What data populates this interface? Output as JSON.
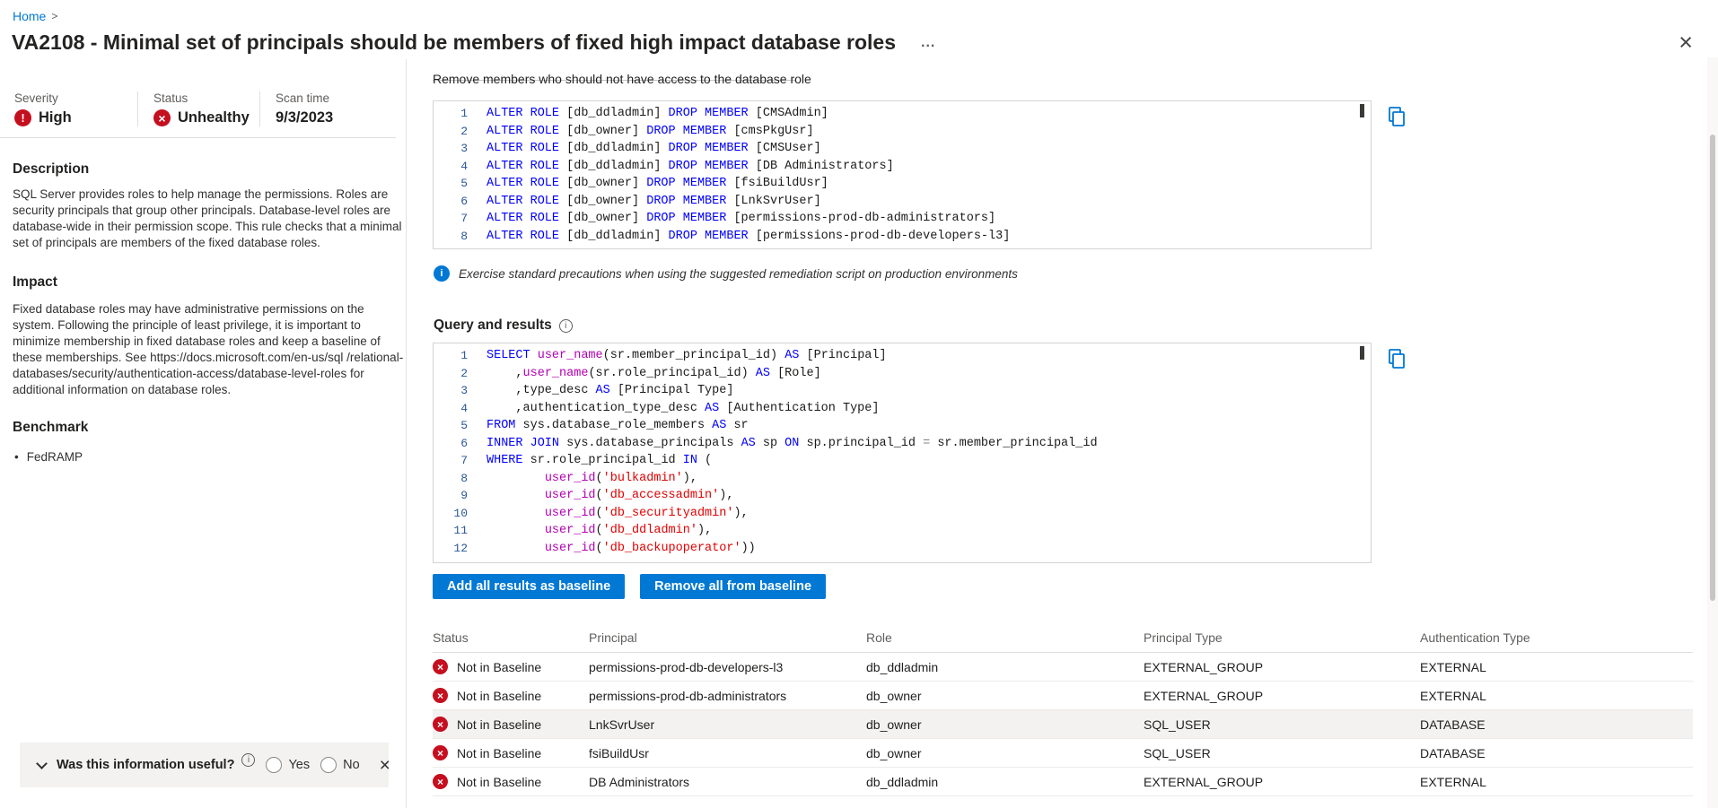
{
  "colors": {
    "accent": "#0078d4",
    "error": "#c50f1f",
    "keyword": "#0000ff",
    "function": "#b300b3",
    "string": "#e00000",
    "operator": "#808080",
    "line_number": "#2b5797"
  },
  "icons": {
    "exclamation": "!",
    "cross": "×",
    "info_i": "i",
    "bullet": "•"
  },
  "breadcrumb": {
    "home": "Home",
    "separator": ">"
  },
  "header": {
    "title": "VA2108 - Minimal set of principals should be members of fixed high impact database roles",
    "more": "...",
    "close": "×"
  },
  "meta": {
    "severity": {
      "label": "Severity",
      "value": "High"
    },
    "status": {
      "label": "Status",
      "value": "Unhealthy"
    },
    "scan": {
      "label": "Scan time",
      "value": "9/3/2023"
    }
  },
  "sidebar": {
    "description": {
      "title": "Description",
      "body": "SQL Server provides roles to help manage the permissions. Roles are security principals that group other principals. Database-level roles are database-wide in their permission scope. This rule checks that a minimal set of principals are members of the fixed database roles."
    },
    "impact": {
      "title": "Impact",
      "body": "Fixed database roles may have administrative permissions on the system. Following the principle of least privilege, it is important to minimize membership in fixed database roles and keep a baseline of these memberships. See https://docs.microsoft.com/en-us/sql /relational-databases/security/authentication-access/database-level-roles for additional information on database roles."
    },
    "benchmark": {
      "title": "Benchmark",
      "items": [
        "FedRAMP"
      ]
    }
  },
  "main": {
    "clipped_heading": "Remove members who should not have access to the database role",
    "remediation": {
      "lines": [
        [
          [
            "k",
            "ALTER ROLE"
          ],
          [
            "p",
            " [db_ddladmin] "
          ],
          [
            "k",
            "DROP MEMBER"
          ],
          [
            "p",
            " [CMSAdmin]"
          ]
        ],
        [
          [
            "k",
            "ALTER ROLE"
          ],
          [
            "p",
            " [db_owner] "
          ],
          [
            "k",
            "DROP MEMBER"
          ],
          [
            "p",
            " [cmsPkgUsr]"
          ]
        ],
        [
          [
            "k",
            "ALTER ROLE"
          ],
          [
            "p",
            " [db_ddladmin] "
          ],
          [
            "k",
            "DROP MEMBER"
          ],
          [
            "p",
            " [CMSUser]"
          ]
        ],
        [
          [
            "k",
            "ALTER ROLE"
          ],
          [
            "p",
            " [db_ddladmin] "
          ],
          [
            "k",
            "DROP MEMBER"
          ],
          [
            "p",
            " [DB Administrators]"
          ]
        ],
        [
          [
            "k",
            "ALTER ROLE"
          ],
          [
            "p",
            " [db_owner] "
          ],
          [
            "k",
            "DROP MEMBER"
          ],
          [
            "p",
            " [fsiBuildUsr]"
          ]
        ],
        [
          [
            "k",
            "ALTER ROLE"
          ],
          [
            "p",
            " [db_owner] "
          ],
          [
            "k",
            "DROP MEMBER"
          ],
          [
            "p",
            " [LnkSvrUser]"
          ]
        ],
        [
          [
            "k",
            "ALTER ROLE"
          ],
          [
            "p",
            " [db_owner] "
          ],
          [
            "k",
            "DROP MEMBER"
          ],
          [
            "p",
            " [permissions-prod-db-administrators]"
          ]
        ],
        [
          [
            "k",
            "ALTER ROLE"
          ],
          [
            "p",
            " [db_ddladmin] "
          ],
          [
            "k",
            "DROP MEMBER"
          ],
          [
            "p",
            " [permissions-prod-db-developers-l3]"
          ]
        ]
      ]
    },
    "note": "Exercise standard precautions when using the suggested remediation script on production environments",
    "query": {
      "title": "Query and results",
      "lines": [
        [
          [
            "k",
            "SELECT"
          ],
          [
            "p",
            " "
          ],
          [
            "f",
            "user_name"
          ],
          [
            "p",
            "(sr.member_principal_id) "
          ],
          [
            "k",
            "AS"
          ],
          [
            "p",
            " [Principal]"
          ]
        ],
        [
          [
            "p",
            "    ,"
          ],
          [
            "f",
            "user_name"
          ],
          [
            "p",
            "(sr.role_principal_id) "
          ],
          [
            "k",
            "AS"
          ],
          [
            "p",
            " [Role]"
          ]
        ],
        [
          [
            "p",
            "    ,type_desc "
          ],
          [
            "k",
            "AS"
          ],
          [
            "p",
            " [Principal Type]"
          ]
        ],
        [
          [
            "p",
            "    ,authentication_type_desc "
          ],
          [
            "k",
            "AS"
          ],
          [
            "p",
            " [Authentication Type]"
          ]
        ],
        [
          [
            "k",
            "FROM"
          ],
          [
            "p",
            " sys.database_role_members "
          ],
          [
            "k",
            "AS"
          ],
          [
            "p",
            " sr"
          ]
        ],
        [
          [
            "k",
            "INNER JOIN"
          ],
          [
            "p",
            " sys.database_principals "
          ],
          [
            "k",
            "AS"
          ],
          [
            "p",
            " sp "
          ],
          [
            "k",
            "ON"
          ],
          [
            "p",
            " sp.principal_id "
          ],
          [
            "o",
            "="
          ],
          [
            "p",
            " sr.member_principal_id"
          ]
        ],
        [
          [
            "k",
            "WHERE"
          ],
          [
            "p",
            " sr.role_principal_id "
          ],
          [
            "k",
            "IN"
          ],
          [
            "p",
            " ("
          ]
        ],
        [
          [
            "p",
            "        "
          ],
          [
            "f",
            "user_id"
          ],
          [
            "p",
            "("
          ],
          [
            "s",
            "'bulkadmin'"
          ],
          [
            "p",
            "),"
          ]
        ],
        [
          [
            "p",
            "        "
          ],
          [
            "f",
            "user_id"
          ],
          [
            "p",
            "("
          ],
          [
            "s",
            "'db_accessadmin'"
          ],
          [
            "p",
            "),"
          ]
        ],
        [
          [
            "p",
            "        "
          ],
          [
            "f",
            "user_id"
          ],
          [
            "p",
            "("
          ],
          [
            "s",
            "'db_securityadmin'"
          ],
          [
            "p",
            "),"
          ]
        ],
        [
          [
            "p",
            "        "
          ],
          [
            "f",
            "user_id"
          ],
          [
            "p",
            "("
          ],
          [
            "s",
            "'db_ddladmin'"
          ],
          [
            "p",
            "),"
          ]
        ],
        [
          [
            "p",
            "        "
          ],
          [
            "f",
            "user_id"
          ],
          [
            "p",
            "("
          ],
          [
            "s",
            "'db_backupoperator'"
          ],
          [
            "p",
            "))"
          ]
        ]
      ]
    },
    "actions": {
      "add_baseline": "Add all results as baseline",
      "remove_baseline": "Remove all from baseline"
    },
    "results_table": {
      "columns": [
        "Status",
        "Principal",
        "Role",
        "Principal Type",
        "Authentication Type"
      ],
      "rows": [
        {
          "status": "Not in Baseline",
          "principal": "permissions-prod-db-developers-l3",
          "role": "db_ddladmin",
          "principal_type": "EXTERNAL_GROUP",
          "auth_type": "EXTERNAL",
          "highlighted": false
        },
        {
          "status": "Not in Baseline",
          "principal": "permissions-prod-db-administrators",
          "role": "db_owner",
          "principal_type": "EXTERNAL_GROUP",
          "auth_type": "EXTERNAL",
          "highlighted": false
        },
        {
          "status": "Not in Baseline",
          "principal": "LnkSvrUser",
          "role": "db_owner",
          "principal_type": "SQL_USER",
          "auth_type": "DATABASE",
          "highlighted": true
        },
        {
          "status": "Not in Baseline",
          "principal": "fsiBuildUsr",
          "role": "db_owner",
          "principal_type": "SQL_USER",
          "auth_type": "DATABASE",
          "highlighted": false
        },
        {
          "status": "Not in Baseline",
          "principal": "DB Administrators",
          "role": "db_ddladmin",
          "principal_type": "EXTERNAL_GROUP",
          "auth_type": "EXTERNAL",
          "highlighted": false
        }
      ]
    }
  },
  "feedback": {
    "question": "Was this information useful?",
    "yes": "Yes",
    "no": "No",
    "close": "×"
  }
}
